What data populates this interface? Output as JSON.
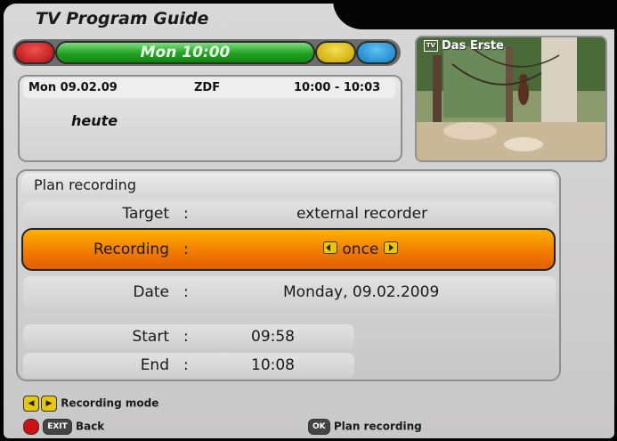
{
  "header": {
    "title": "TV Program Guide",
    "green_button_label": "Mon 10:00"
  },
  "program": {
    "date": "Mon 09.02.09",
    "channel": "ZDF",
    "time_range": "10:00 - 10:03",
    "title": "heute"
  },
  "preview": {
    "channel_name": "Das Erste",
    "icon": "tv-icon"
  },
  "plan": {
    "title": "Plan recording",
    "rows": {
      "target": {
        "label": "Target",
        "colon": ":",
        "value": "external recorder"
      },
      "recording": {
        "label": "Recording",
        "colon": ":",
        "value": "once"
      },
      "date": {
        "label": "Date",
        "colon": ":",
        "value": "Monday, 09.02.2009"
      },
      "start": {
        "label": "Start",
        "colon": ":",
        "value": "09:58"
      },
      "end": {
        "label": "End",
        "colon": ":",
        "value": "10:08"
      }
    }
  },
  "footer": {
    "mode_hint": "Recording mode",
    "exit_key": "EXIT",
    "back_label": "Back",
    "ok_key": "OK",
    "plan_label": "Plan recording"
  },
  "colors": {
    "highlight": "#f08000",
    "panel": "#d0d0d0",
    "green_button": "#22a022"
  }
}
